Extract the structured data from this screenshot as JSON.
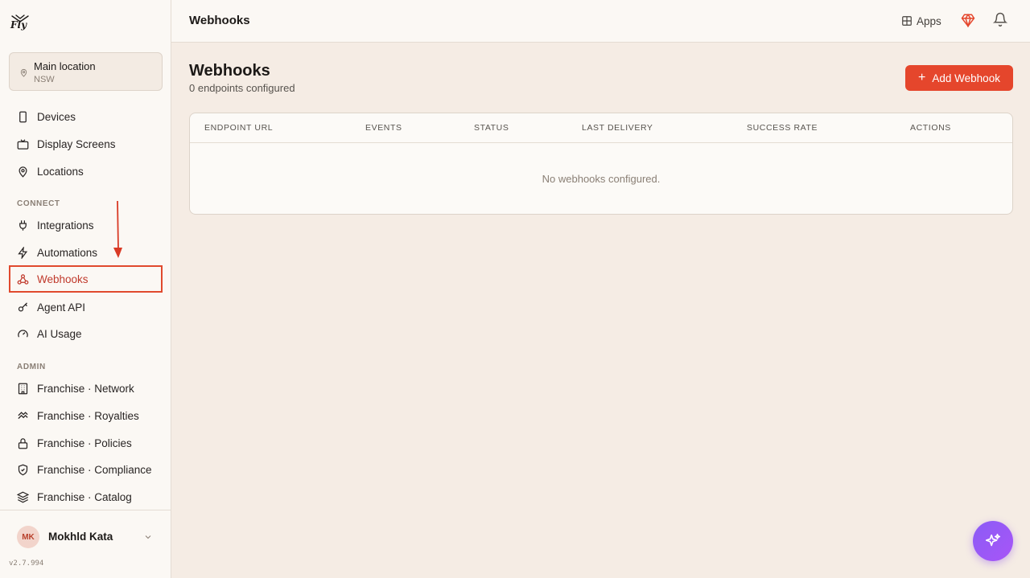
{
  "logo_text": "Fly",
  "location": {
    "name": "Main location",
    "region": "NSW"
  },
  "nav": {
    "main": [
      {
        "label": "Devices",
        "icon": "phone-icon"
      },
      {
        "label": "Display Screens",
        "icon": "tv-icon"
      },
      {
        "label": "Locations",
        "icon": "map-pin-icon"
      }
    ],
    "connect_label": "CONNECT",
    "connect": [
      {
        "label": "Integrations",
        "icon": "plug-icon"
      },
      {
        "label": "Automations",
        "icon": "zap-icon"
      },
      {
        "label": "Webhooks",
        "icon": "webhook-icon",
        "active": true
      },
      {
        "label": "Agent API",
        "icon": "key-icon"
      },
      {
        "label": "AI Usage",
        "icon": "gauge-icon"
      }
    ],
    "admin_label": "ADMIN",
    "admin": [
      {
        "label": "Franchise · Network",
        "icon": "building-icon"
      },
      {
        "label": "Franchise · Royalties",
        "icon": "coins-icon"
      },
      {
        "label": "Franchise · Policies",
        "icon": "lock-icon"
      },
      {
        "label": "Franchise · Compliance",
        "icon": "shield-icon"
      },
      {
        "label": "Franchise · Catalog",
        "icon": "layers-icon"
      }
    ]
  },
  "user": {
    "initials": "MK",
    "name": "Mokhld Kata"
  },
  "version": "v2.7.994",
  "topbar": {
    "title": "Webhooks",
    "apps_label": "Apps"
  },
  "page": {
    "title": "Webhooks",
    "subtitle": "0 endpoints configured",
    "add_button_label": "Add Webhook"
  },
  "table": {
    "columns": [
      "ENDPOINT URL",
      "EVENTS",
      "STATUS",
      "LAST DELIVERY",
      "SUCCESS RATE",
      "ACTIONS"
    ],
    "empty_message": "No webhooks configured."
  },
  "colors": {
    "accent": "#e5462c",
    "active_border": "#e04a2e",
    "fab": "#8b5cf6"
  }
}
